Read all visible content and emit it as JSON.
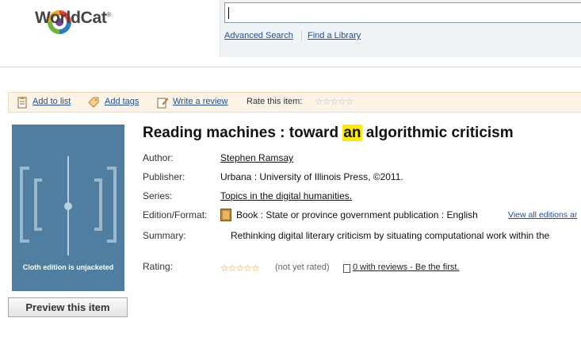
{
  "header": {
    "logo_text": "WorldCat",
    "logo_mark": "®",
    "search_input_value": "",
    "advanced_search": "Advanced Search",
    "find_library": "Find a Library"
  },
  "toolbar": {
    "add_to_list": "Add to list",
    "add_tags": "Add tags",
    "write_review": "Write a review",
    "rate_label": "Rate this item:",
    "rating_stars": "☆☆☆☆☆"
  },
  "cover": {
    "caption": "Cloth edition is unjacketed",
    "background": "#4f7ea0"
  },
  "preview_button": "Preview this item",
  "record": {
    "title_before": "Reading machines : toward ",
    "title_highlight": "an",
    "title_after": " algorithmic criticism",
    "author_label": "Author:",
    "author": "Stephen Ramsay",
    "publisher_label": "Publisher:",
    "publisher": "Urbana : University of Illinois Press, ©2011.",
    "series_label": "Series:",
    "series": "Topics in the digital humanities.",
    "format_label": "Edition/Format:",
    "format": "Book : State or province government publication : English",
    "view_all": "View all editions ar",
    "summary_label": "Summary:",
    "summary": "Rethinking digital literary criticism by situating computational work within the",
    "rating_label": "Rating:",
    "rating_stars": "☆☆☆☆☆",
    "not_rated": "(not yet rated)",
    "reviews": "0 with reviews - Be the first."
  },
  "colors": {
    "link": "#1f4e9c",
    "highlight": "#ffea00",
    "toolbar_bg": "#fdf3e6",
    "star_orange": "#f0932b"
  }
}
